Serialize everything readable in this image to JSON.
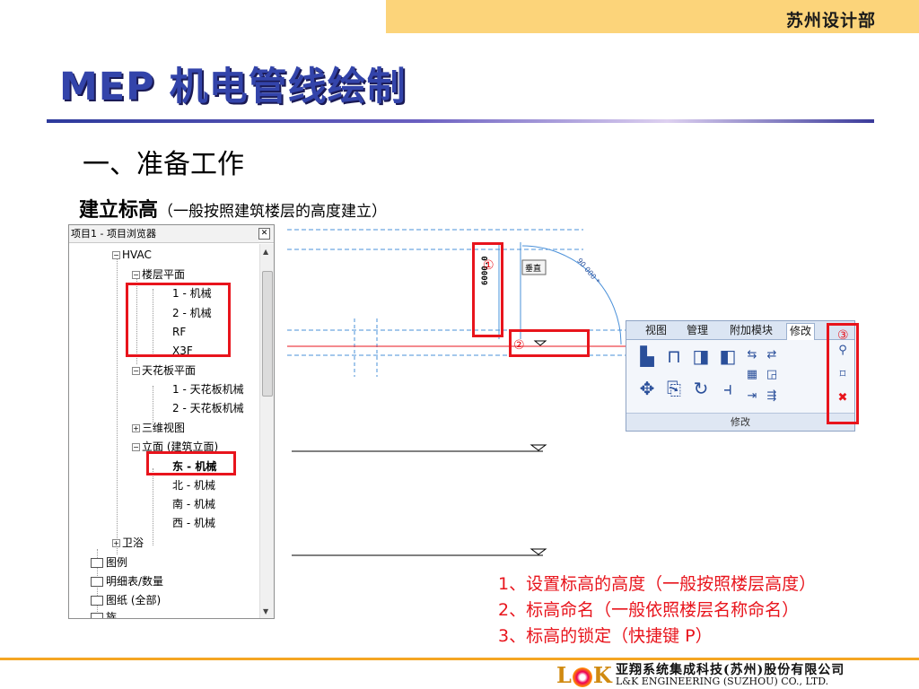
{
  "header": {
    "department": "苏州设计部"
  },
  "title": "MEP 机电管线绘制",
  "section_heading": "一、准备工作",
  "subheading": {
    "main": "建立标高",
    "note": "（一般按照建筑楼层的高度建立）"
  },
  "project_browser": {
    "title": "项目1 - 项目浏览器",
    "close_icon": "close-icon",
    "tree": [
      {
        "label": "HVAC",
        "expanded": true
      },
      {
        "label": "楼层平面",
        "expanded": true
      },
      {
        "label": "1 - 机械"
      },
      {
        "label": "2 - 机械"
      },
      {
        "label": "RF"
      },
      {
        "label": "X3F"
      },
      {
        "label": "天花板平面",
        "expanded": true
      },
      {
        "label": "1 - 天花板机械"
      },
      {
        "label": "2 - 天花板机械"
      },
      {
        "label": "三维视图",
        "expanded": false
      },
      {
        "label": "立面 (建筑立面)",
        "expanded": true
      },
      {
        "label": "东 - 机械",
        "selected": true
      },
      {
        "label": "北 - 机械"
      },
      {
        "label": "南 - 机械"
      },
      {
        "label": "西 - 机械"
      },
      {
        "label": "卫浴",
        "expanded": false
      },
      {
        "label": "图例"
      },
      {
        "label": "明细表/数量"
      },
      {
        "label": "图纸 (全部)"
      },
      {
        "label": "族"
      }
    ]
  },
  "drawing": {
    "dimension_text": "6000.0",
    "tag_label": "垂直",
    "radius_text": "90 000 *",
    "level_marker": "①",
    "name_marker": "②",
    "lock_marker": "③"
  },
  "ribbon": {
    "tabs": [
      "视图",
      "管理",
      "附加模块",
      "修改"
    ],
    "active_tab": "修改",
    "panel_label": "修改"
  },
  "notes": [
    "1、设置标高的高度（一般按照楼层高度）",
    "2、标高命名（一般依照楼层名称命名）",
    "3、标高的锁定（快捷键 P）"
  ],
  "footer": {
    "logo_l": "L",
    "logo_k": "K",
    "company_cn": "亚翔系统集成科技(苏州)股份有限公司",
    "company_en": "L&K ENGINEERING (SUZHOU) CO., LTD."
  },
  "colors": {
    "accent_red": "#e8141c",
    "title_blue": "#3344aa",
    "tab_yellow": "#fcd47a",
    "footer_orange": "#f5a623"
  }
}
